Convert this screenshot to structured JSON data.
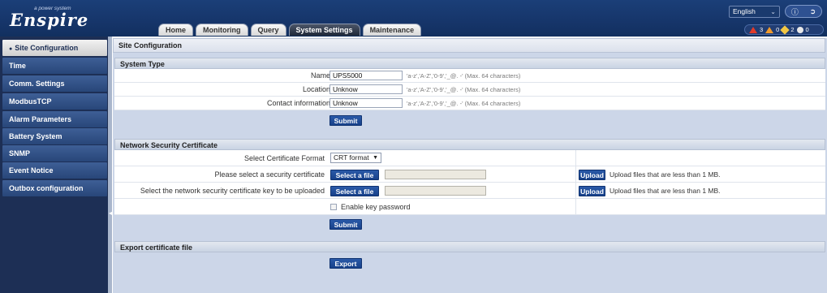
{
  "header": {
    "brand": "Enspire",
    "brand_tag": "a power system",
    "tabs": [
      {
        "label": "Home",
        "active": false
      },
      {
        "label": "Monitoring",
        "active": false
      },
      {
        "label": "Query",
        "active": false
      },
      {
        "label": "System Settings",
        "active": true
      },
      {
        "label": "Maintenance",
        "active": false
      }
    ],
    "language": "English",
    "alarms": {
      "critical": "3",
      "major": "0",
      "minor": "2",
      "warning": "0"
    }
  },
  "sidebar": {
    "items": [
      {
        "label": "Site Configuration",
        "active": true
      },
      {
        "label": "Time",
        "active": false
      },
      {
        "label": "Comm. Settings",
        "active": false
      },
      {
        "label": "ModbusTCP",
        "active": false
      },
      {
        "label": "Alarm Parameters",
        "active": false
      },
      {
        "label": "Battery System",
        "active": false
      },
      {
        "label": "SNMP",
        "active": false
      },
      {
        "label": "Event Notice",
        "active": false
      },
      {
        "label": "Outbox configuration",
        "active": false
      }
    ]
  },
  "page": {
    "title": "Site Configuration",
    "system_type": {
      "heading": "System Type",
      "fields": [
        {
          "label": "Name",
          "value": "UPS5000",
          "hint": "'a-z','A-Z','0-9','_@. -' (Max. 64 characters)"
        },
        {
          "label": "Location",
          "value": "Unknow",
          "hint": "'a-z','A-Z','0-9','_@. -' (Max. 64 characters)"
        },
        {
          "label": "Contact information",
          "value": "Unknow",
          "hint": "'a-z','A-Z','0-9','_@. -' (Max. 64 characters)"
        }
      ],
      "submit_label": "Submit"
    },
    "network_cert": {
      "heading": "Network Security Certificate",
      "format_label": "Select Certificate Format",
      "format_value": "CRT format",
      "cert_label": "Please select a security certificate",
      "key_label": "Select the network security certificate key to be uploaded",
      "select_file_label": "Select a file",
      "upload_label": "Upload",
      "upload_hint": "Upload files that are less than 1 MB.",
      "enable_key_password": "Enable key password",
      "submit_label": "Submit"
    },
    "export": {
      "heading": "Export certificate file",
      "export_label": "Export"
    }
  }
}
